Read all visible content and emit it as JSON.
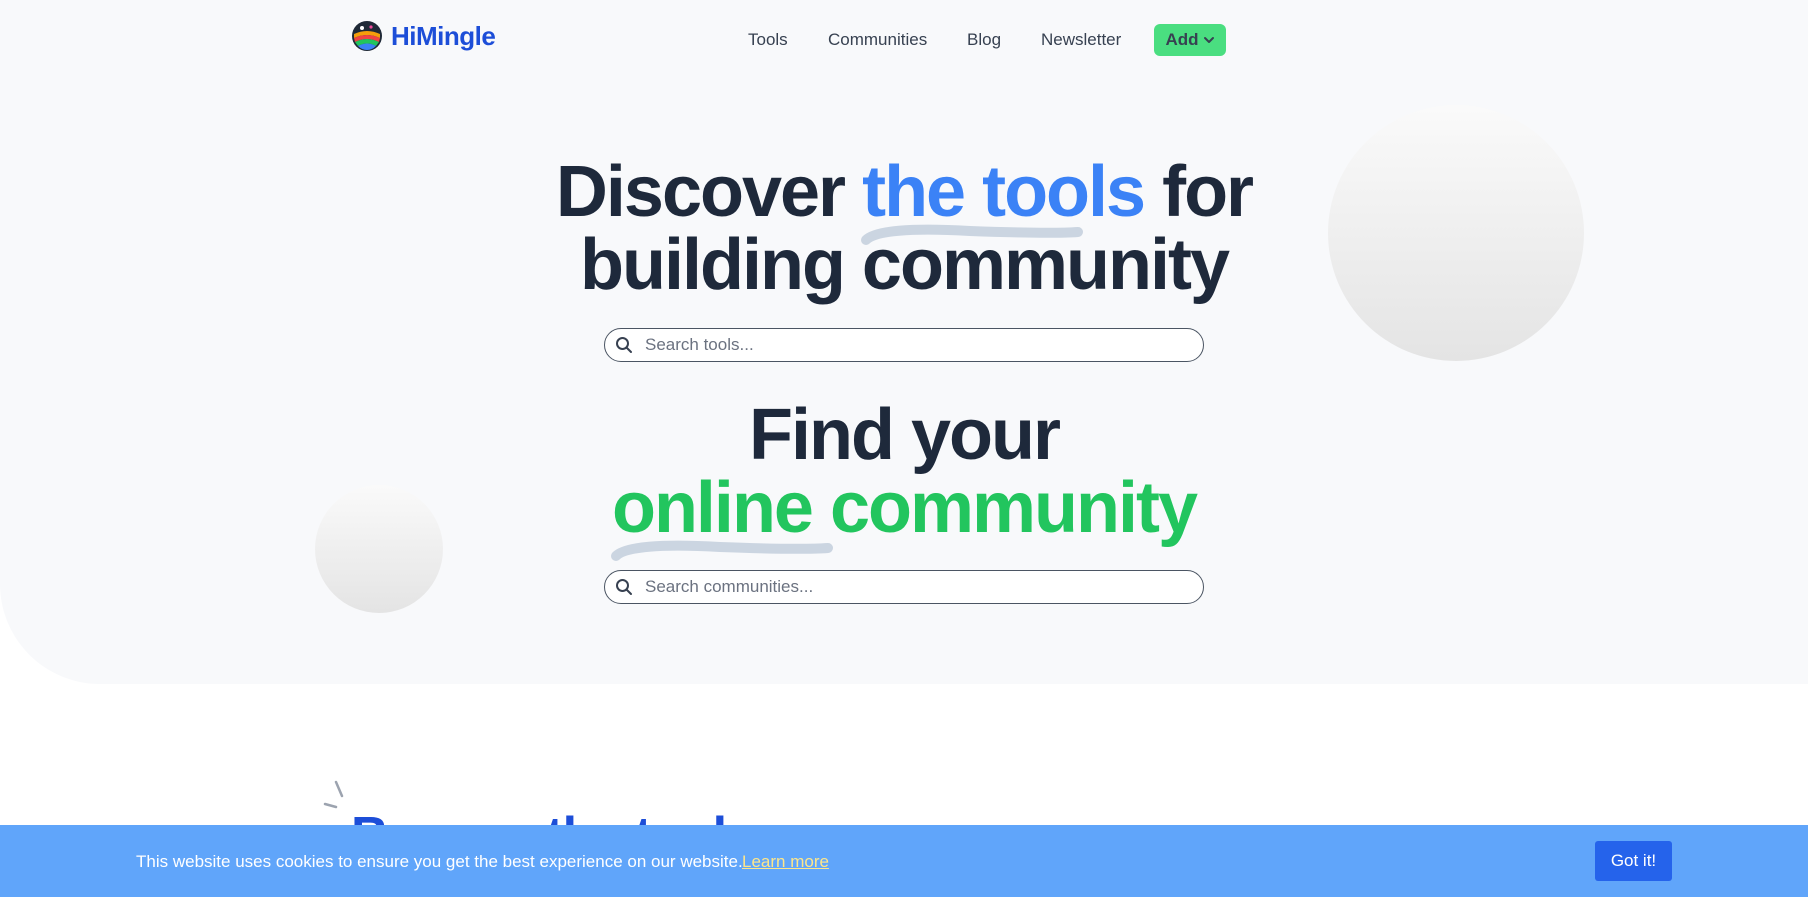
{
  "brand": {
    "name": "HiMingle",
    "logo_icon": "colorful-globe-logo"
  },
  "nav": {
    "items": [
      "Tools",
      "Communities",
      "Blog",
      "Newsletter"
    ],
    "add_label": "Add",
    "add_icon": "chevron-down-icon"
  },
  "hero": {
    "tools_headline": {
      "part1": "Discover ",
      "highlight": "the tools",
      "part2": " for",
      "line2": "building community"
    },
    "tools_search": {
      "placeholder": "Search tools..."
    },
    "communities_headline": {
      "line1": "Find your",
      "highlight": "online community"
    },
    "communities_search": {
      "placeholder": "Search communities..."
    }
  },
  "section": {
    "title": "Browse the tools"
  },
  "cookie": {
    "message": "This website uses cookies to ensure you get the best experience on our website.",
    "learn_more": "Learn more",
    "accept": "Got it!"
  },
  "colors": {
    "brand_blue": "#1d4ed8",
    "highlight_blue": "#3b82f6",
    "highlight_green": "#22c55e",
    "add_button": "#4ade80",
    "cookie_bar": "#60a5fa",
    "cookie_button": "#2563eb"
  }
}
